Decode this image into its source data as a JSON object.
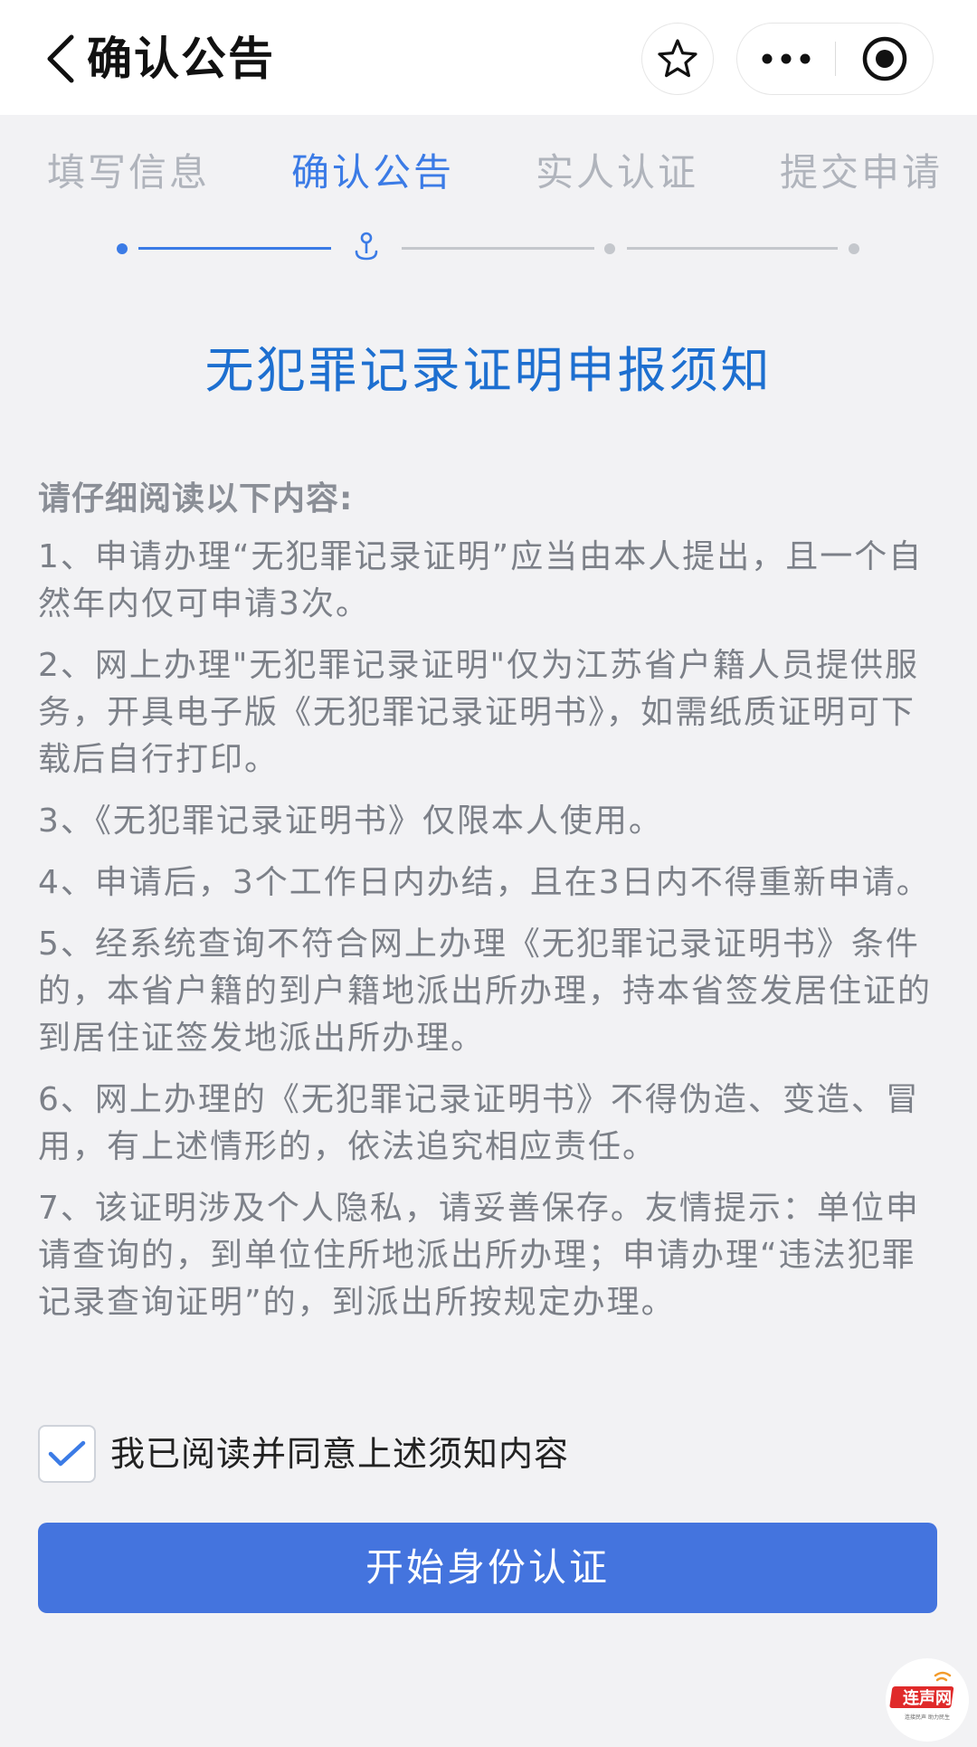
{
  "header": {
    "title": "确认公告",
    "back_icon": "chevron-left-icon",
    "favorite_icon": "star-icon",
    "more_icon": "more-dots-icon",
    "close_icon": "target-circle-icon"
  },
  "steps": [
    {
      "label": "填写信息",
      "state": "done"
    },
    {
      "label": "确认公告",
      "state": "current"
    },
    {
      "label": "实人认证",
      "state": "todo"
    },
    {
      "label": "提交申请",
      "state": "todo"
    }
  ],
  "notice": {
    "title": "无犯罪记录证明申报须知",
    "heading": "请仔细阅读以下内容:",
    "items": [
      "1、申请办理“无犯罪记录证明”应当由本人提出，且一个自然年内仅可申请3次。",
      "2、网上办理\"无犯罪记录证明\"仅为江苏省户籍人员提供服务，开具电子版《无犯罪记录证明书》，如需纸质证明可下载后自行打印。",
      "3、《无犯罪记录证明书》仅限本人使用。",
      "4、申请后，3个工作日内办结，且在3日内不得重新申请。",
      "5、经系统查询不符合网上办理《无犯罪记录证明书》条件的，本省户籍的到户籍地派出所办理，持本省签发居住证的到居住证签发地派出所办理。",
      "6、网上办理的《无犯罪记录证明书》不得伪造、变造、冒用，有上述情形的，依法追究相应责任。",
      "7、该证明涉及个人隐私，请妥善保存。友情提示：单位申请查询的，到单位住所地派出所办理；申请办理“违法犯罪记录查询证明”的，到派出所按规定办理。"
    ]
  },
  "agreement": {
    "checked": true,
    "label": "我已阅读并同意上述须知内容"
  },
  "primary_button": {
    "label": "开始身份认证"
  },
  "watermark": {
    "logo_text": "连声网",
    "slogan": "连接民声 助力民生"
  },
  "colors": {
    "accent": "#3b7be6",
    "title_blue": "#1d6fd0",
    "button_blue": "#4474de",
    "inactive": "#b0b4bc",
    "watermark_red": "#e02a2a"
  }
}
